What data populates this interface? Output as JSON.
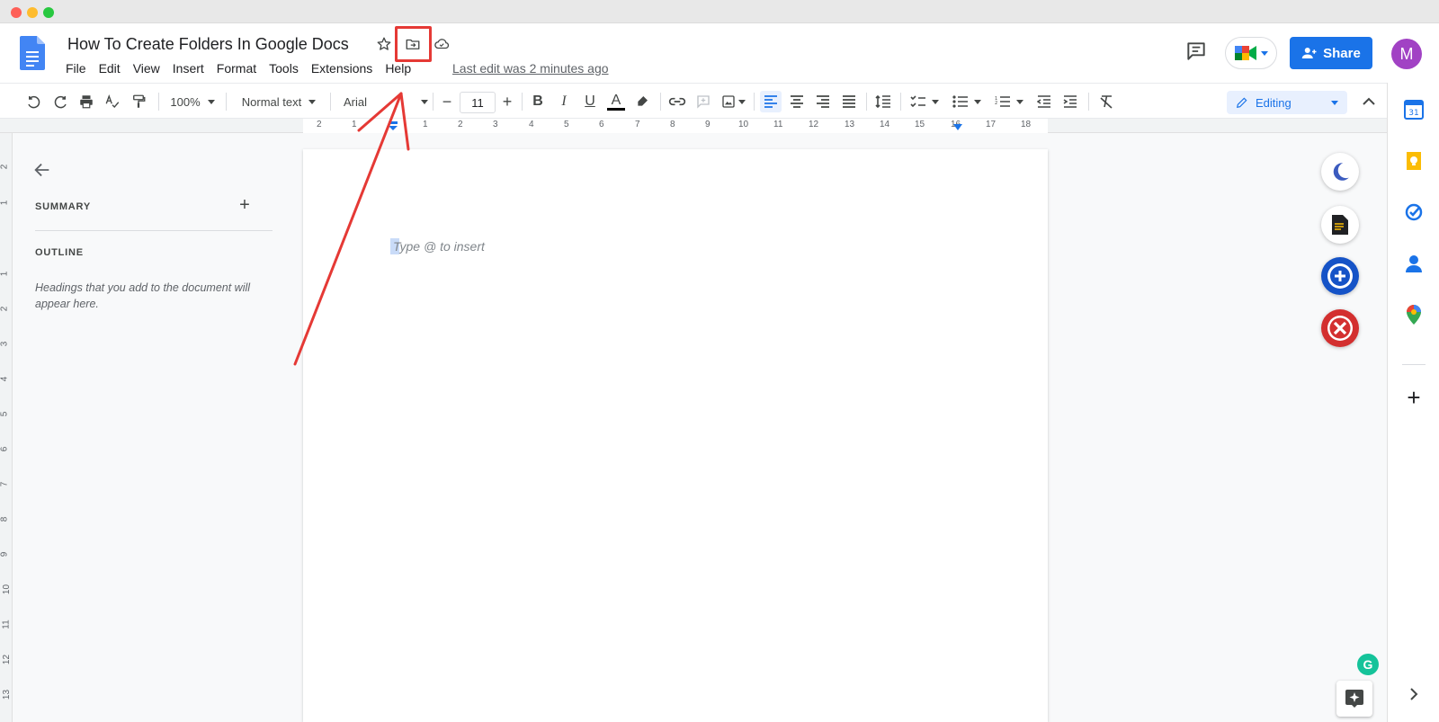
{
  "app": {
    "doc_title": "How To Create Folders In Google Docs",
    "last_edit": "Last edit was 2 minutes ago",
    "share_label": "Share",
    "avatar_initial": "M",
    "brand_blue": "#1a73e8",
    "annotation_color": "#e53935"
  },
  "menu": [
    "File",
    "Edit",
    "View",
    "Insert",
    "Format",
    "Tools",
    "Extensions",
    "Help"
  ],
  "toolbar": {
    "zoom": "100%",
    "style": "Normal text",
    "font": "Arial",
    "font_size": "11",
    "mode": "Editing"
  },
  "ruler": {
    "h_numbers": [
      "2",
      "1",
      "1",
      "2",
      "3",
      "4",
      "5",
      "6",
      "7",
      "8",
      "9",
      "10",
      "11",
      "12",
      "13",
      "14",
      "15",
      "16",
      "17",
      "18"
    ],
    "v_numbers": [
      "2",
      "1",
      "1",
      "2",
      "3",
      "4",
      "5",
      "6",
      "7",
      "8",
      "9",
      "10",
      "11",
      "12",
      "13"
    ]
  },
  "outline": {
    "summary_label": "SUMMARY",
    "add_label": "+",
    "outline_label": "OUTLINE",
    "hint": "Headings that you add to the document will appear here."
  },
  "page": {
    "placeholder": "Type @ to insert"
  },
  "side_panel": {
    "calendar_day": "31",
    "add_label": "+"
  },
  "grammarly_label": "G"
}
